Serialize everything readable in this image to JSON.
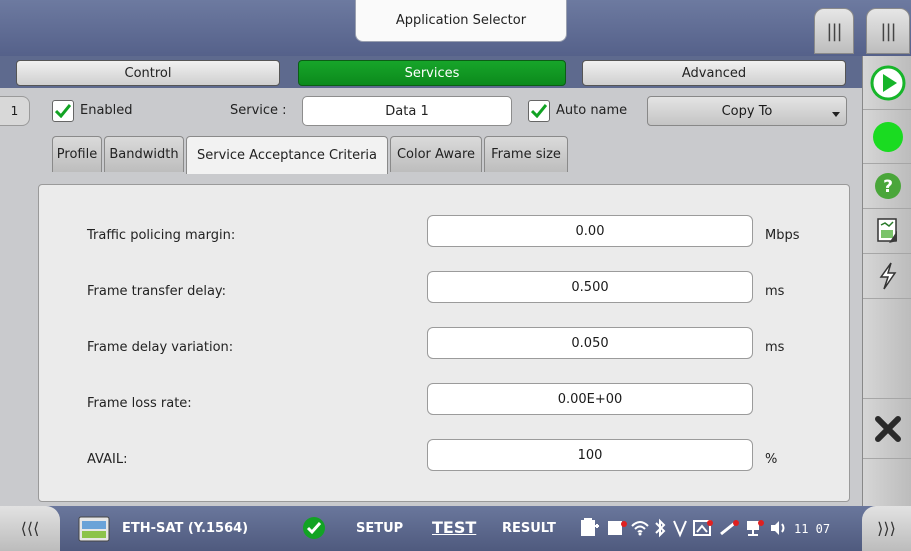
{
  "header": {
    "title": "Application Selector",
    "menu_grip_symbol": "|||"
  },
  "main_tabs": [
    {
      "label": "Control",
      "active": false
    },
    {
      "label": "Services",
      "active": true
    },
    {
      "label": "Advanced",
      "active": false
    }
  ],
  "service_row": {
    "service_number": "1",
    "enabled_label": "Enabled",
    "enabled_checked": true,
    "service_label": "Service :",
    "service_value": "Data 1",
    "auto_name_label": "Auto name",
    "auto_name_checked": true,
    "copy_to_label": "Copy To"
  },
  "sub_tabs": [
    {
      "label": "Profile",
      "active": false
    },
    {
      "label": "Bandwidth",
      "active": false
    },
    {
      "label": "Service Acceptance Criteria",
      "active": true
    },
    {
      "label": "Color Aware",
      "active": false
    },
    {
      "label": "Frame size",
      "active": false
    }
  ],
  "parameters": [
    {
      "label": "Traffic policing margin:",
      "value": "0.00",
      "unit": "Mbps"
    },
    {
      "label": "Frame transfer delay:",
      "value": "0.500",
      "unit": "ms"
    },
    {
      "label": "Frame delay variation:",
      "value": "0.050",
      "unit": "ms"
    },
    {
      "label": "Frame loss rate:",
      "value": "0.00E+00",
      "unit": ""
    },
    {
      "label": "AVAIL:",
      "value": "100",
      "unit": "%"
    }
  ],
  "sidebar_icons": [
    "play-icon",
    "status-led-icon",
    "help-icon",
    "report-icon",
    "lightning-icon",
    "close-icon"
  ],
  "statusbar": {
    "left_tab_symbol": "⟨⟨⟨",
    "right_tab_symbol": "⟩⟩⟩",
    "test_name": "ETH-SAT (Y.1564)",
    "setup": "SETUP",
    "test": "TEST",
    "result": "RESULT",
    "clock": "11 07"
  },
  "colors": {
    "accent_green": "#12a324",
    "play_green": "#17b52a",
    "led_green": "#1adb21",
    "help_green": "#4aa63a",
    "close_dark": "#2a2a2a"
  }
}
